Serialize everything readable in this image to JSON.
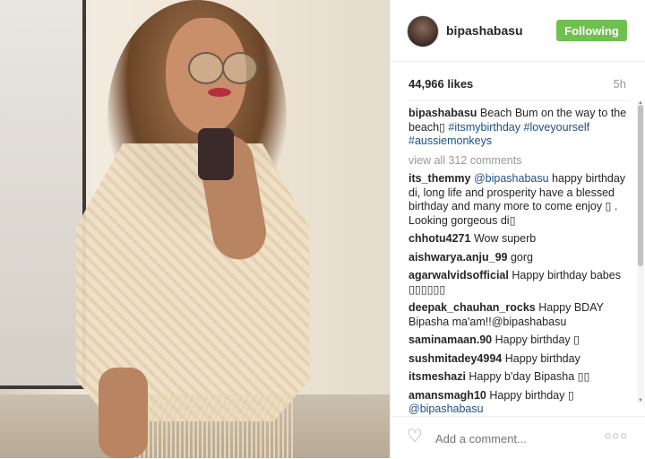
{
  "header": {
    "username": "bipashabasu",
    "follow_label": "Following",
    "follow_color": "#70c050"
  },
  "stats": {
    "likes": "44,966 likes",
    "time": "5h"
  },
  "caption": {
    "user": "bipashabasu",
    "text": "Beach Bum on the way to the beach▯",
    "tag1": "#itsmybirthday",
    "tag2": "#loveyourself",
    "tag3": "#aussiemonkeys"
  },
  "view_all": "view all 312 comments",
  "comments": [
    {
      "user": "its_themmy",
      "mention": "@bipashabasu",
      "text": "happy birthday di, long life and prosperity have a blessed birthday and many more to come enjoy ▯ . Looking gorgeous di▯"
    },
    {
      "user": "chhotu4271",
      "text": "Wow superb"
    },
    {
      "user": "aishwarya.anju_99",
      "text": "gorg"
    },
    {
      "user": "agarwalvidsofficial",
      "text": "Happy birthday babes ▯▯▯▯▯▯"
    },
    {
      "user": "deepak_chauhan_rocks",
      "text": "Happy BDAY Bipasha ma'am!!@bipashabasu"
    },
    {
      "user": "saminamaan.90",
      "text": "Happy birthday ▯"
    },
    {
      "user": "sushmitadey4994",
      "text": "Happy birthday"
    },
    {
      "user": "itsmeshazi",
      "text": "Happy b'day Bipasha ▯▯"
    },
    {
      "user": "amansmagh10",
      "text": "Happy birthday ▯",
      "mention": "@bipashabasu"
    }
  ],
  "footer": {
    "placeholder": "Add a comment...",
    "more": "○○○"
  },
  "icons": {
    "like": "heart-icon",
    "more": "more-options-icon"
  }
}
